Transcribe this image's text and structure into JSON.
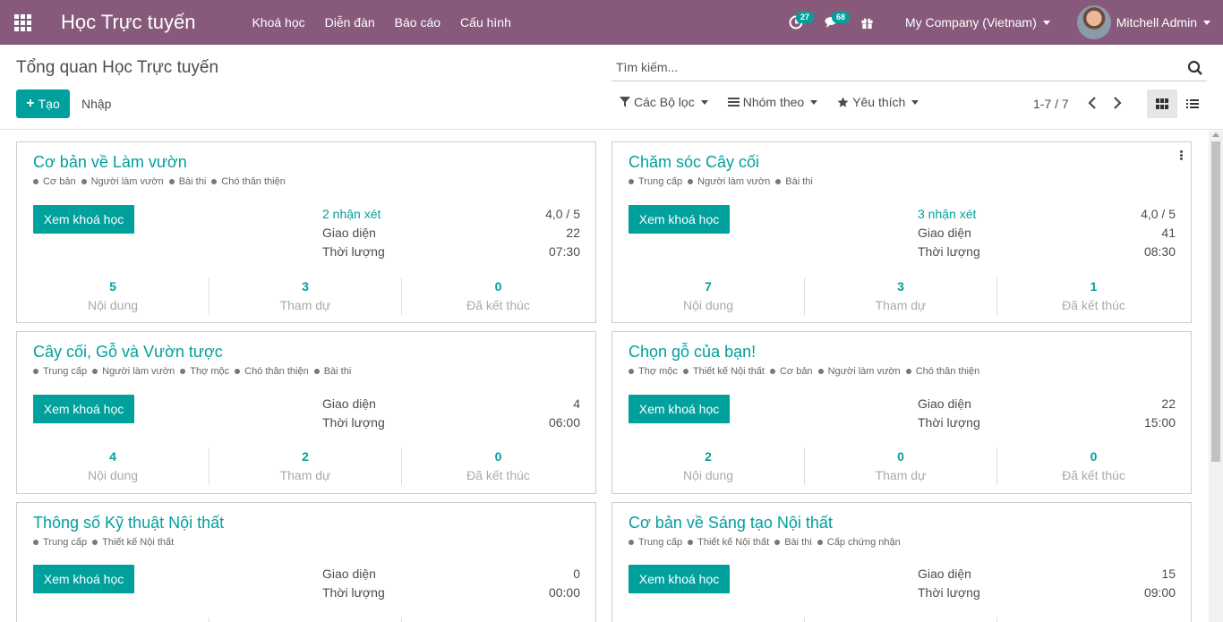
{
  "navbar": {
    "app_title": "Học Trực tuyến",
    "menu": [
      "Khoá học",
      "Diễn đàn",
      "Báo cáo",
      "Cấu hình"
    ],
    "activity_count": "27",
    "message_count": "68",
    "company": "My Company (Vietnam)",
    "user": "Mitchell Admin",
    "brand_color": "#875a7b"
  },
  "control_panel": {
    "breadcrumb": "Tổng quan Học Trực tuyến",
    "search_placeholder": "Tìm kiếm...",
    "create_label": "Tạo",
    "import_label": "Nhập",
    "filters_label": "Các Bộ lọc",
    "group_by_label": "Nhóm theo",
    "favorites_label": "Yêu thích",
    "pager": "1-7 / 7"
  },
  "cards": [
    {
      "title": "Cơ bản về Làm vườn",
      "tags": [
        "Cơ bản",
        "Người làm vườn",
        "Bài thi",
        "Chó thân thiện"
      ],
      "button": "Xem khoá học",
      "reviews": "2 nhận xét",
      "rating": "4,0 / 5",
      "views_label": "Giao diện",
      "views": "22",
      "duration_label": "Thời lượng",
      "duration": "07:30",
      "content_count": "5",
      "content_label": "Nội dung",
      "attendees_count": "3",
      "attendees_label": "Tham dự",
      "finished_count": "0",
      "finished_label": "Đã kết thúc"
    },
    {
      "title": "Chăm sóc Cây cối",
      "tags": [
        "Trung cấp",
        "Người làm vườn",
        "Bài thi"
      ],
      "button": "Xem khoá học",
      "reviews": "3 nhận xét",
      "rating": "4,0 / 5",
      "views_label": "Giao diện",
      "views": "41",
      "duration_label": "Thời lượng",
      "duration": "08:30",
      "content_count": "7",
      "content_label": "Nội dung",
      "attendees_count": "3",
      "attendees_label": "Tham dự",
      "finished_count": "1",
      "finished_label": "Đã kết thúc"
    },
    {
      "title": "Cây cối, Gỗ và Vườn tược",
      "tags": [
        "Trung cấp",
        "Người làm vườn",
        "Thợ mộc",
        "Chó thân thiện",
        "Bài thi"
      ],
      "button": "Xem khoá học",
      "views_label": "Giao diện",
      "views": "4",
      "duration_label": "Thời lượng",
      "duration": "06:00",
      "content_count": "4",
      "content_label": "Nội dung",
      "attendees_count": "2",
      "attendees_label": "Tham dự",
      "finished_count": "0",
      "finished_label": "Đã kết thúc"
    },
    {
      "title": "Chọn gỗ của bạn!",
      "tags": [
        "Thợ mộc",
        "Thiết kế Nội thất",
        "Cơ bản",
        "Người làm vườn",
        "Chó thân thiện"
      ],
      "button": "Xem khoá học",
      "views_label": "Giao diện",
      "views": "22",
      "duration_label": "Thời lượng",
      "duration": "15:00",
      "content_count": "2",
      "content_label": "Nội dung",
      "attendees_count": "0",
      "attendees_label": "Tham dự",
      "finished_count": "0",
      "finished_label": "Đã kết thúc"
    },
    {
      "title": "Thông số Kỹ thuật Nội thất",
      "tags": [
        "Trung cấp",
        "Thiết kế Nội thất"
      ],
      "button": "Xem khoá học",
      "views_label": "Giao diện",
      "views": "0",
      "duration_label": "Thời lượng",
      "duration": "00:00"
    },
    {
      "title": "Cơ bản về Sáng tạo Nội thất",
      "tags": [
        "Trung cấp",
        "Thiết kế Nội thất",
        "Bài thi",
        "Cấp chứng nhận"
      ],
      "button": "Xem khoá học",
      "views_label": "Giao diện",
      "views": "15",
      "duration_label": "Thời lượng",
      "duration": "09:00"
    }
  ]
}
